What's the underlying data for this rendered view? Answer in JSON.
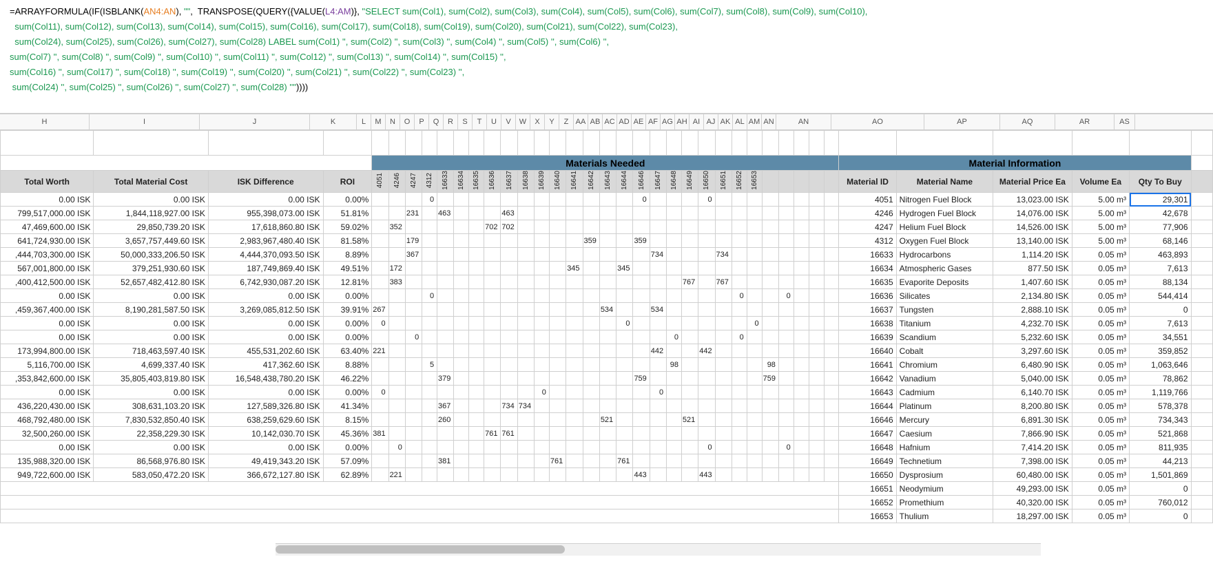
{
  "formula": {
    "raw": "=ARRAYFORMULA(IF(ISBLANK(AN4:AN), \"\", TRANSPOSE(QUERY({VALUE(L4:AM)}, \"SELECT sum(Col1), sum(Col2), sum(Col3), sum(Col4), sum(Col5), sum(Col6), sum(Col7), sum(Col8), sum(Col9), sum(Col10),\n  sum(Col11), sum(Col12), sum(Col13), sum(Col14), sum(Col15), sum(Col16), sum(Col17), sum(Col18), sum(Col19), sum(Col20), sum(Col21), sum(Col22), sum(Col23),\n  sum(Col24), sum(Col25), sum(Col26), sum(Col27), sum(Col28) LABEL sum(Col1) '', sum(Col2) '', sum(Col3) '', sum(Col4) '', sum(Col5) '', sum(Col6) '',\nsum(Col7) '', sum(Col8) '', sum(Col9) '', sum(Col10) '', sum(Col11) '', sum(Col12) '', sum(Col13) '', sum(Col14) '', sum(Col15) '',\nsum(Col16) '', sum(Col17) '', sum(Col18) '', sum(Col19) '', sum(Col20) '', sum(Col21) '', sum(Col22) '', sum(Col23) '',\n sum(Col24) '', sum(Col25) '', sum(Col26) '', sum(Col27) '', sum(Col28) ''\"))))"
  },
  "column_letters": [
    "H",
    "I",
    "J",
    "K",
    "L",
    "M",
    "N",
    "O",
    "P",
    "Q",
    "R",
    "S",
    "T",
    "U",
    "V",
    "W",
    "X",
    "Y",
    "Z",
    "AA",
    "AB",
    "AC",
    "AD",
    "AE",
    "AF",
    "AG",
    "AH",
    "AI",
    "AJ",
    "AK",
    "AL",
    "AM",
    "AN",
    "AO",
    "AP",
    "AQ",
    "AR",
    "AS"
  ],
  "sections": {
    "materials_needed": "Materials Needed",
    "material_info": "Material Information"
  },
  "main_headers": {
    "total_worth": "Total Worth",
    "total_material_cost": "Total Material Cost",
    "isk_diff": "ISK Difference",
    "roi": "ROI"
  },
  "mat_col_ids": [
    "4051",
    "4246",
    "4247",
    "4312",
    "16633",
    "16634",
    "16635",
    "16636",
    "16637",
    "16638",
    "16639",
    "16640",
    "16641",
    "16642",
    "16643",
    "16644",
    "16646",
    "16647",
    "16648",
    "16649",
    "16650",
    "16651",
    "16652",
    "16653",
    "",
    "",
    "",
    "",
    ""
  ],
  "info_headers": {
    "mid": "Material ID",
    "mname": "Material Name",
    "mprice": "Material Price Ea",
    "mvol": "Volume Ea",
    "mqty": "Qty To Buy"
  },
  "rows": [
    {
      "tw": "0.00 ISK",
      "tmc": "0.00 ISK",
      "diff": "0.00 ISK",
      "roi": "0.00%",
      "m": [
        "",
        "",
        "",
        "0",
        "",
        "",
        "",
        "",
        "",
        "",
        "",
        "",
        "",
        "",
        "",
        "",
        "0",
        "",
        "",
        "",
        "0",
        "",
        "",
        "",
        "",
        "",
        "",
        ""
      ]
    },
    {
      "tw": "799,517,000.00 ISK",
      "tmc": "1,844,118,927.00 ISK",
      "diff": "955,398,073.00 ISK",
      "roi": "51.81%",
      "m": [
        "",
        "",
        "231",
        "",
        "463",
        "",
        "",
        "",
        "463",
        "",
        "",
        "",
        "",
        "",
        "",
        "",
        "",
        "",
        "",
        "",
        "",
        "",
        "",
        "",
        "",
        "",
        "",
        ""
      ]
    },
    {
      "tw": "47,469,600.00 ISK",
      "tmc": "29,850,739.20 ISK",
      "diff": "17,618,860.80 ISK",
      "roi": "59.02%",
      "m": [
        "",
        "352",
        "",
        "",
        "",
        "",
        "",
        "702",
        "702",
        "",
        "",
        "",
        "",
        "",
        "",
        "",
        "",
        "",
        "",
        "",
        "",
        "",
        "",
        "",
        "",
        "",
        "",
        ""
      ]
    },
    {
      "tw": "641,724,930.00 ISK",
      "tmc": "3,657,757,449.60 ISK",
      "diff": "2,983,967,480.40 ISK",
      "roi": "81.58%",
      "m": [
        "",
        "",
        "179",
        "",
        "",
        "",
        "",
        "",
        "",
        "",
        "",
        "",
        "",
        "359",
        "",
        "",
        "359",
        "",
        "",
        "",
        "",
        "",
        "",
        "",
        "",
        "",
        "",
        ""
      ]
    },
    {
      "tw": ",444,703,300.00 ISK",
      "tmc": "50,000,333,206.50 ISK",
      "diff": "4,444,370,093.50 ISK",
      "roi": "8.89%",
      "m": [
        "",
        "",
        "367",
        "",
        "",
        "",
        "",
        "",
        "",
        "",
        "",
        "",
        "",
        "",
        "",
        "",
        "",
        "734",
        "",
        "",
        "",
        "734",
        "",
        "",
        "",
        "",
        "",
        ""
      ]
    },
    {
      "tw": "567,001,800.00 ISK",
      "tmc": "379,251,930.60 ISK",
      "diff": "187,749,869.40 ISK",
      "roi": "49.51%",
      "m": [
        "",
        "172",
        "",
        "",
        "",
        "",
        "",
        "",
        "",
        "",
        "",
        "",
        "345",
        "",
        "",
        "345",
        "",
        "",
        "",
        "",
        "",
        "",
        "",
        "",
        "",
        "",
        "",
        ""
      ]
    },
    {
      "tw": ",400,412,500.00 ISK",
      "tmc": "52,657,482,412.80 ISK",
      "diff": "6,742,930,087.20 ISK",
      "roi": "12.81%",
      "m": [
        "",
        "383",
        "",
        "",
        "",
        "",
        "",
        "",
        "",
        "",
        "",
        "",
        "",
        "",
        "",
        "",
        "",
        "",
        "",
        "767",
        "",
        "767",
        "",
        "",
        "",
        "",
        "",
        ""
      ]
    },
    {
      "tw": "0.00 ISK",
      "tmc": "0.00 ISK",
      "diff": "0.00 ISK",
      "roi": "0.00%",
      "m": [
        "",
        "",
        "",
        "0",
        "",
        "",
        "",
        "",
        "",
        "",
        "",
        "",
        "",
        "",
        "",
        "",
        "",
        "",
        "",
        "",
        "",
        "",
        "0",
        "",
        "",
        "0",
        "",
        "",
        ""
      ]
    },
    {
      "tw": ",459,367,400.00 ISK",
      "tmc": "8,190,281,587.50 ISK",
      "diff": "3,269,085,812.50 ISK",
      "roi": "39.91%",
      "m": [
        "267",
        "",
        "",
        "",
        "",
        "",
        "",
        "",
        "",
        "",
        "",
        "",
        "",
        "",
        "534",
        "",
        "",
        "534",
        "",
        "",
        "",
        "",
        "",
        "",
        "",
        "",
        "",
        ""
      ]
    },
    {
      "tw": "0.00 ISK",
      "tmc": "0.00 ISK",
      "diff": "0.00 ISK",
      "roi": "0.00%",
      "m": [
        "0",
        "",
        "",
        "",
        "",
        "",
        "",
        "",
        "",
        "",
        "",
        "",
        "",
        "",
        "",
        "0",
        "",
        "",
        "",
        "",
        "",
        "",
        "",
        "0",
        "",
        "",
        "",
        ""
      ]
    },
    {
      "tw": "0.00 ISK",
      "tmc": "0.00 ISK",
      "diff": "0.00 ISK",
      "roi": "0.00%",
      "m": [
        "",
        "",
        "0",
        "",
        "",
        "",
        "",
        "",
        "",
        "",
        "",
        "",
        "",
        "",
        "",
        "",
        "",
        "",
        "0",
        "",
        "",
        "",
        "0",
        "",
        "",
        "",
        "",
        ""
      ]
    },
    {
      "tw": "173,994,800.00 ISK",
      "tmc": "718,463,597.40 ISK",
      "diff": "455,531,202.60 ISK",
      "roi": "63.40%",
      "m": [
        "221",
        "",
        "",
        "",
        "",
        "",
        "",
        "",
        "",
        "",
        "",
        "",
        "",
        "",
        "",
        "",
        "",
        "442",
        "",
        "",
        "442",
        "",
        "",
        "",
        "",
        "",
        "",
        ""
      ]
    },
    {
      "tw": "5,116,700.00 ISK",
      "tmc": "4,699,337.40 ISK",
      "diff": "417,362.60 ISK",
      "roi": "8.88%",
      "m": [
        "",
        "",
        "",
        "5",
        "",
        "",
        "",
        "",
        "",
        "",
        "",
        "",
        "",
        "",
        "",
        "",
        "",
        "",
        "98",
        "",
        "",
        "",
        "",
        "",
        "98",
        "",
        "",
        ""
      ]
    },
    {
      "tw": ",353,842,600.00 ISK",
      "tmc": "35,805,403,819.80 ISK",
      "diff": "16,548,438,780.20 ISK",
      "roi": "46.22%",
      "m": [
        "",
        "",
        "",
        "",
        "379",
        "",
        "",
        "",
        "",
        "",
        "",
        "",
        "",
        "",
        "",
        "",
        "759",
        "",
        "",
        "",
        "",
        "",
        "",
        "",
        "759",
        "",
        "",
        ""
      ]
    },
    {
      "tw": "0.00 ISK",
      "tmc": "0.00 ISK",
      "diff": "0.00 ISK",
      "roi": "0.00%",
      "m": [
        "0",
        "",
        "",
        "",
        "",
        "",
        "",
        "",
        "",
        "",
        "0",
        "",
        "",
        "",
        "",
        "",
        "",
        "0",
        "",
        "",
        "",
        "",
        "",
        "",
        "",
        "",
        "",
        ""
      ]
    },
    {
      "tw": "436,220,430.00 ISK",
      "tmc": "308,631,103.20 ISK",
      "diff": "127,589,326.80 ISK",
      "roi": "41.34%",
      "m": [
        "",
        "",
        "",
        "",
        "367",
        "",
        "",
        "",
        "734",
        "734",
        "",
        "",
        "",
        "",
        "",
        "",
        "",
        "",
        "",
        "",
        "",
        "",
        "",
        "",
        "",
        "",
        "",
        ""
      ]
    },
    {
      "tw": "468,792,480.00 ISK",
      "tmc": "7,830,532,850.40 ISK",
      "diff": "638,259,629.60 ISK",
      "roi": "8.15%",
      "m": [
        "",
        "",
        "",
        "",
        "260",
        "",
        "",
        "",
        "",
        "",
        "",
        "",
        "",
        "",
        "521",
        "",
        "",
        "",
        "",
        "521",
        "",
        "",
        "",
        "",
        "",
        "",
        "",
        ""
      ]
    },
    {
      "tw": "32,500,260.00 ISK",
      "tmc": "22,358,229.30 ISK",
      "diff": "10,142,030.70 ISK",
      "roi": "45.36%",
      "m": [
        "381",
        "",
        "",
        "",
        "",
        "",
        "",
        "761",
        "761",
        "",
        "",
        "",
        "",
        "",
        "",
        "",
        "",
        "",
        "",
        "",
        "",
        "",
        "",
        "",
        "",
        "",
        "",
        ""
      ]
    },
    {
      "tw": "0.00 ISK",
      "tmc": "0.00 ISK",
      "diff": "0.00 ISK",
      "roi": "0.00%",
      "m": [
        "",
        "0",
        "",
        "",
        "",
        "",
        "",
        "",
        "",
        "",
        "",
        "",
        "",
        "",
        "",
        "",
        "",
        "",
        "",
        "",
        "0",
        "",
        "",
        "",
        "",
        "0",
        "",
        "",
        ""
      ]
    },
    {
      "tw": "135,988,320.00 ISK",
      "tmc": "86,568,976.80 ISK",
      "diff": "49,419,343.20 ISK",
      "roi": "57.09%",
      "m": [
        "",
        "",
        "",
        "",
        "381",
        "",
        "",
        "",
        "",
        "",
        "",
        "761",
        "",
        "",
        "",
        "761",
        "",
        "",
        "",
        "",
        "",
        "",
        "",
        "",
        "",
        "",
        "",
        ""
      ]
    },
    {
      "tw": "949,722,600.00 ISK",
      "tmc": "583,050,472.20 ISK",
      "diff": "366,672,127.80 ISK",
      "roi": "62.89%",
      "m": [
        "",
        "221",
        "",
        "",
        "",
        "",
        "",
        "",
        "",
        "",
        "",
        "",
        "",
        "",
        "",
        "",
        "443",
        "",
        "",
        "",
        "443",
        "",
        "",
        "",
        "",
        "",
        "",
        ""
      ]
    }
  ],
  "materials": [
    {
      "id": "4051",
      "name": "Nitrogen Fuel Block",
      "price": "13,023.00 ISK",
      "vol": "5.00 m³",
      "qty": "29,301",
      "sel": true
    },
    {
      "id": "4246",
      "name": "Hydrogen Fuel Block",
      "price": "14,076.00 ISK",
      "vol": "5.00 m³",
      "qty": "42,678"
    },
    {
      "id": "4247",
      "name": "Helium Fuel Block",
      "price": "14,526.00 ISK",
      "vol": "5.00 m³",
      "qty": "77,906"
    },
    {
      "id": "4312",
      "name": "Oxygen Fuel Block",
      "price": "13,140.00 ISK",
      "vol": "5.00 m³",
      "qty": "68,146"
    },
    {
      "id": "16633",
      "name": "Hydrocarbons",
      "price": "1,114.20 ISK",
      "vol": "0.05 m³",
      "qty": "463,893"
    },
    {
      "id": "16634",
      "name": "Atmospheric Gases",
      "price": "877.50 ISK",
      "vol": "0.05 m³",
      "qty": "7,613"
    },
    {
      "id": "16635",
      "name": "Evaporite Deposits",
      "price": "1,407.60 ISK",
      "vol": "0.05 m³",
      "qty": "88,134"
    },
    {
      "id": "16636",
      "name": "Silicates",
      "price": "2,134.80 ISK",
      "vol": "0.05 m³",
      "qty": "544,414"
    },
    {
      "id": "16637",
      "name": "Tungsten",
      "price": "2,888.10 ISK",
      "vol": "0.05 m³",
      "qty": "0"
    },
    {
      "id": "16638",
      "name": "Titanium",
      "price": "4,232.70 ISK",
      "vol": "0.05 m³",
      "qty": "7,613"
    },
    {
      "id": "16639",
      "name": "Scandium",
      "price": "5,232.60 ISK",
      "vol": "0.05 m³",
      "qty": "34,551"
    },
    {
      "id": "16640",
      "name": "Cobalt",
      "price": "3,297.60 ISK",
      "vol": "0.05 m³",
      "qty": "359,852"
    },
    {
      "id": "16641",
      "name": "Chromium",
      "price": "6,480.90 ISK",
      "vol": "0.05 m³",
      "qty": "1,063,646"
    },
    {
      "id": "16642",
      "name": "Vanadium",
      "price": "5,040.00 ISK",
      "vol": "0.05 m³",
      "qty": "78,862"
    },
    {
      "id": "16643",
      "name": "Cadmium",
      "price": "6,140.70 ISK",
      "vol": "0.05 m³",
      "qty": "1,119,766"
    },
    {
      "id": "16644",
      "name": "Platinum",
      "price": "8,200.80 ISK",
      "vol": "0.05 m³",
      "qty": "578,378"
    },
    {
      "id": "16646",
      "name": "Mercury",
      "price": "6,891.30 ISK",
      "vol": "0.05 m³",
      "qty": "734,343"
    },
    {
      "id": "16647",
      "name": "Caesium",
      "price": "7,866.90 ISK",
      "vol": "0.05 m³",
      "qty": "521,868"
    },
    {
      "id": "16648",
      "name": "Hafnium",
      "price": "7,414.20 ISK",
      "vol": "0.05 m³",
      "qty": "811,935"
    },
    {
      "id": "16649",
      "name": "Technetium",
      "price": "7,398.00 ISK",
      "vol": "0.05 m³",
      "qty": "44,213"
    },
    {
      "id": "16650",
      "name": "Dysprosium",
      "price": "60,480.00 ISK",
      "vol": "0.05 m³",
      "qty": "1,501,869"
    },
    {
      "id": "16651",
      "name": "Neodymium",
      "price": "49,293.00 ISK",
      "vol": "0.05 m³",
      "qty": "0"
    },
    {
      "id": "16652",
      "name": "Promethium",
      "price": "40,320.00 ISK",
      "vol": "0.05 m³",
      "qty": "760,012"
    },
    {
      "id": "16653",
      "name": "Thulium",
      "price": "18,297.00 ISK",
      "vol": "0.05 m³",
      "qty": "0"
    }
  ],
  "widths": {
    "H": 130,
    "I": 160,
    "J": 160,
    "K": 68,
    "mat": 21,
    "AN": 80,
    "AO": 135,
    "AP": 110,
    "AQ": 80,
    "AR": 86,
    "AS": 30
  }
}
